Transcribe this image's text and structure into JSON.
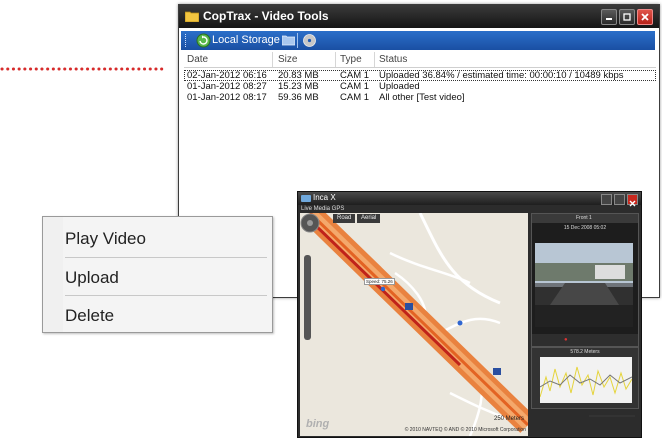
{
  "main_window": {
    "title": "CopTrax - Video Tools",
    "toolbar": {
      "storage_label": "Local Storage"
    },
    "columns": [
      "Date",
      "Size",
      "Type",
      "Status"
    ],
    "rows": [
      {
        "date": "02-Jan-2012 06:16",
        "size": "20.83 MB",
        "type": "CAM 1",
        "status": "Uploaded 36.84% / estimated time: 00:00:10 / 10489 kbps",
        "selected": true
      },
      {
        "date": "01-Jan-2012 08:27",
        "size": "15.23 MB",
        "type": "CAM 1",
        "status": "Uploaded",
        "selected": false
      },
      {
        "date": "01-Jan-2012 08:17",
        "size": "59.36 MB",
        "type": "CAM 1",
        "status": "All other [Test video]",
        "selected": false
      }
    ]
  },
  "context_menu": {
    "items": [
      "Play Video",
      "Upload",
      "Delete"
    ]
  },
  "inca_window": {
    "title": "Inca X",
    "subtitle": "Live Media GPS",
    "map_tabs": [
      "Road",
      "Aerial"
    ],
    "pin_label": "Speed: 75.26",
    "video_header": "Front 1",
    "video_date": "15 Dec 2008 05:02",
    "graph_label": "578.2 Meters",
    "scale_label": "250 Meters",
    "copyright": "© 2010 NAVTEQ  © AND  © 2010 Microsoft Corporation",
    "logo": "bing"
  },
  "colors": {
    "titlebar": "#1e1e1e",
    "toolbar": "#1f5bb5",
    "route": "#ee6a2a",
    "close": "#c8281e"
  }
}
